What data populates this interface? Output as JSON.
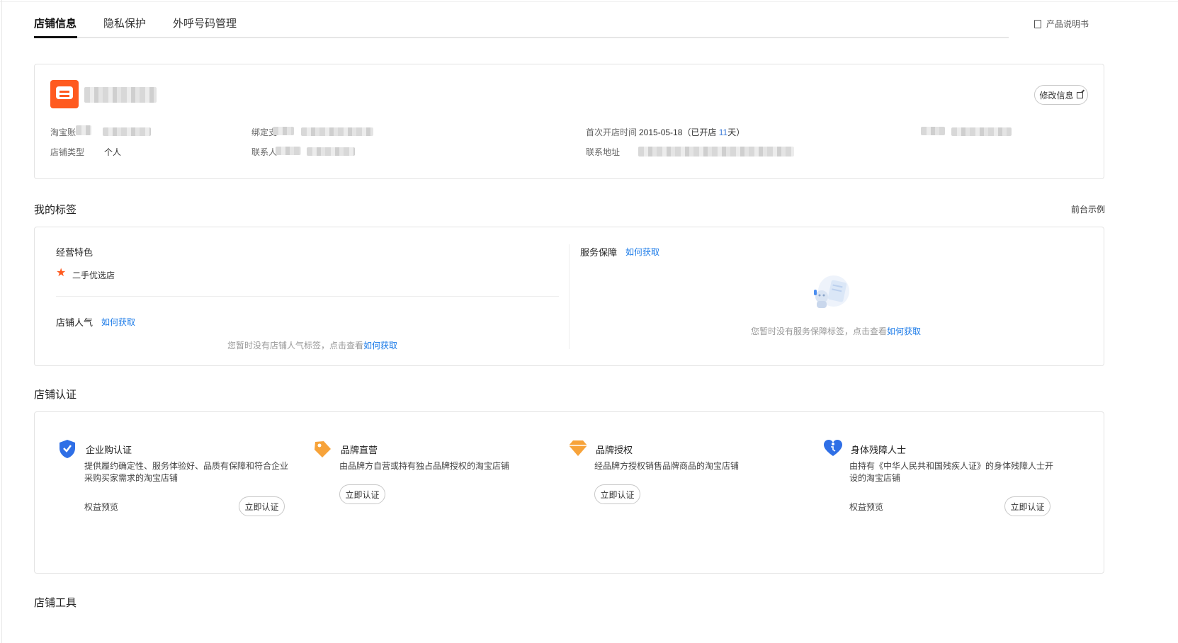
{
  "tabs": [
    {
      "label": "店铺信息"
    },
    {
      "label": "隐私保护"
    },
    {
      "label": "外呼号码管理"
    }
  ],
  "manual_label": "产品说明书",
  "shop": {
    "edit_label": "修改信息",
    "open_time_label": "首次开店时间",
    "open_time_value": "2015-05-18（已开店",
    "open_days": "11",
    "open_days_suffix": "天）",
    "type_label": "店铺类型",
    "type_value": "个人",
    "address_label": "联系地址",
    "taobao_label_partial": "淘宝账",
    "bind_label_partial": "绑定支",
    "contact_label_partial": "联系人"
  },
  "tags_section": {
    "title": "我的标签",
    "frontend_example": "前台示例",
    "business_label": "经营特色",
    "business_item": "二手优选店",
    "popularity_label": "店铺人气",
    "how_to_get": "如何获取",
    "popularity_empty": "您暂时没有店铺人气标签，点击查看",
    "service_label": "服务保障",
    "service_empty": "您暂时没有服务保障标签，点击查看"
  },
  "cert_section": {
    "title": "店铺认证",
    "items": [
      {
        "title": "企业购认证",
        "desc": "提供履约确定性、服务体验好、品质有保障和符合企业采购买家需求的淘宝店铺",
        "preview": "权益预览",
        "button": "立即认证"
      },
      {
        "title": "品牌直营",
        "desc": "由品牌方自营或持有独占品牌授权的淘宝店铺",
        "button": "立即认证"
      },
      {
        "title": "品牌授权",
        "desc": "经品牌方授权销售品牌商品的淘宝店铺",
        "button": "立即认证"
      },
      {
        "title": "身体残障人士",
        "desc": "由持有《中华人民共和国残疾人证》的身体残障人士开设的淘宝店铺",
        "preview": "权益预览",
        "button": "立即认证"
      }
    ]
  },
  "tools_section": {
    "title": "店铺工具"
  },
  "colors": {
    "accent_link": "#1a7ae8",
    "brand_orange": "#ff5a1f",
    "shield_blue": "#2f6fe6",
    "tag_orange": "#f7a33a"
  }
}
